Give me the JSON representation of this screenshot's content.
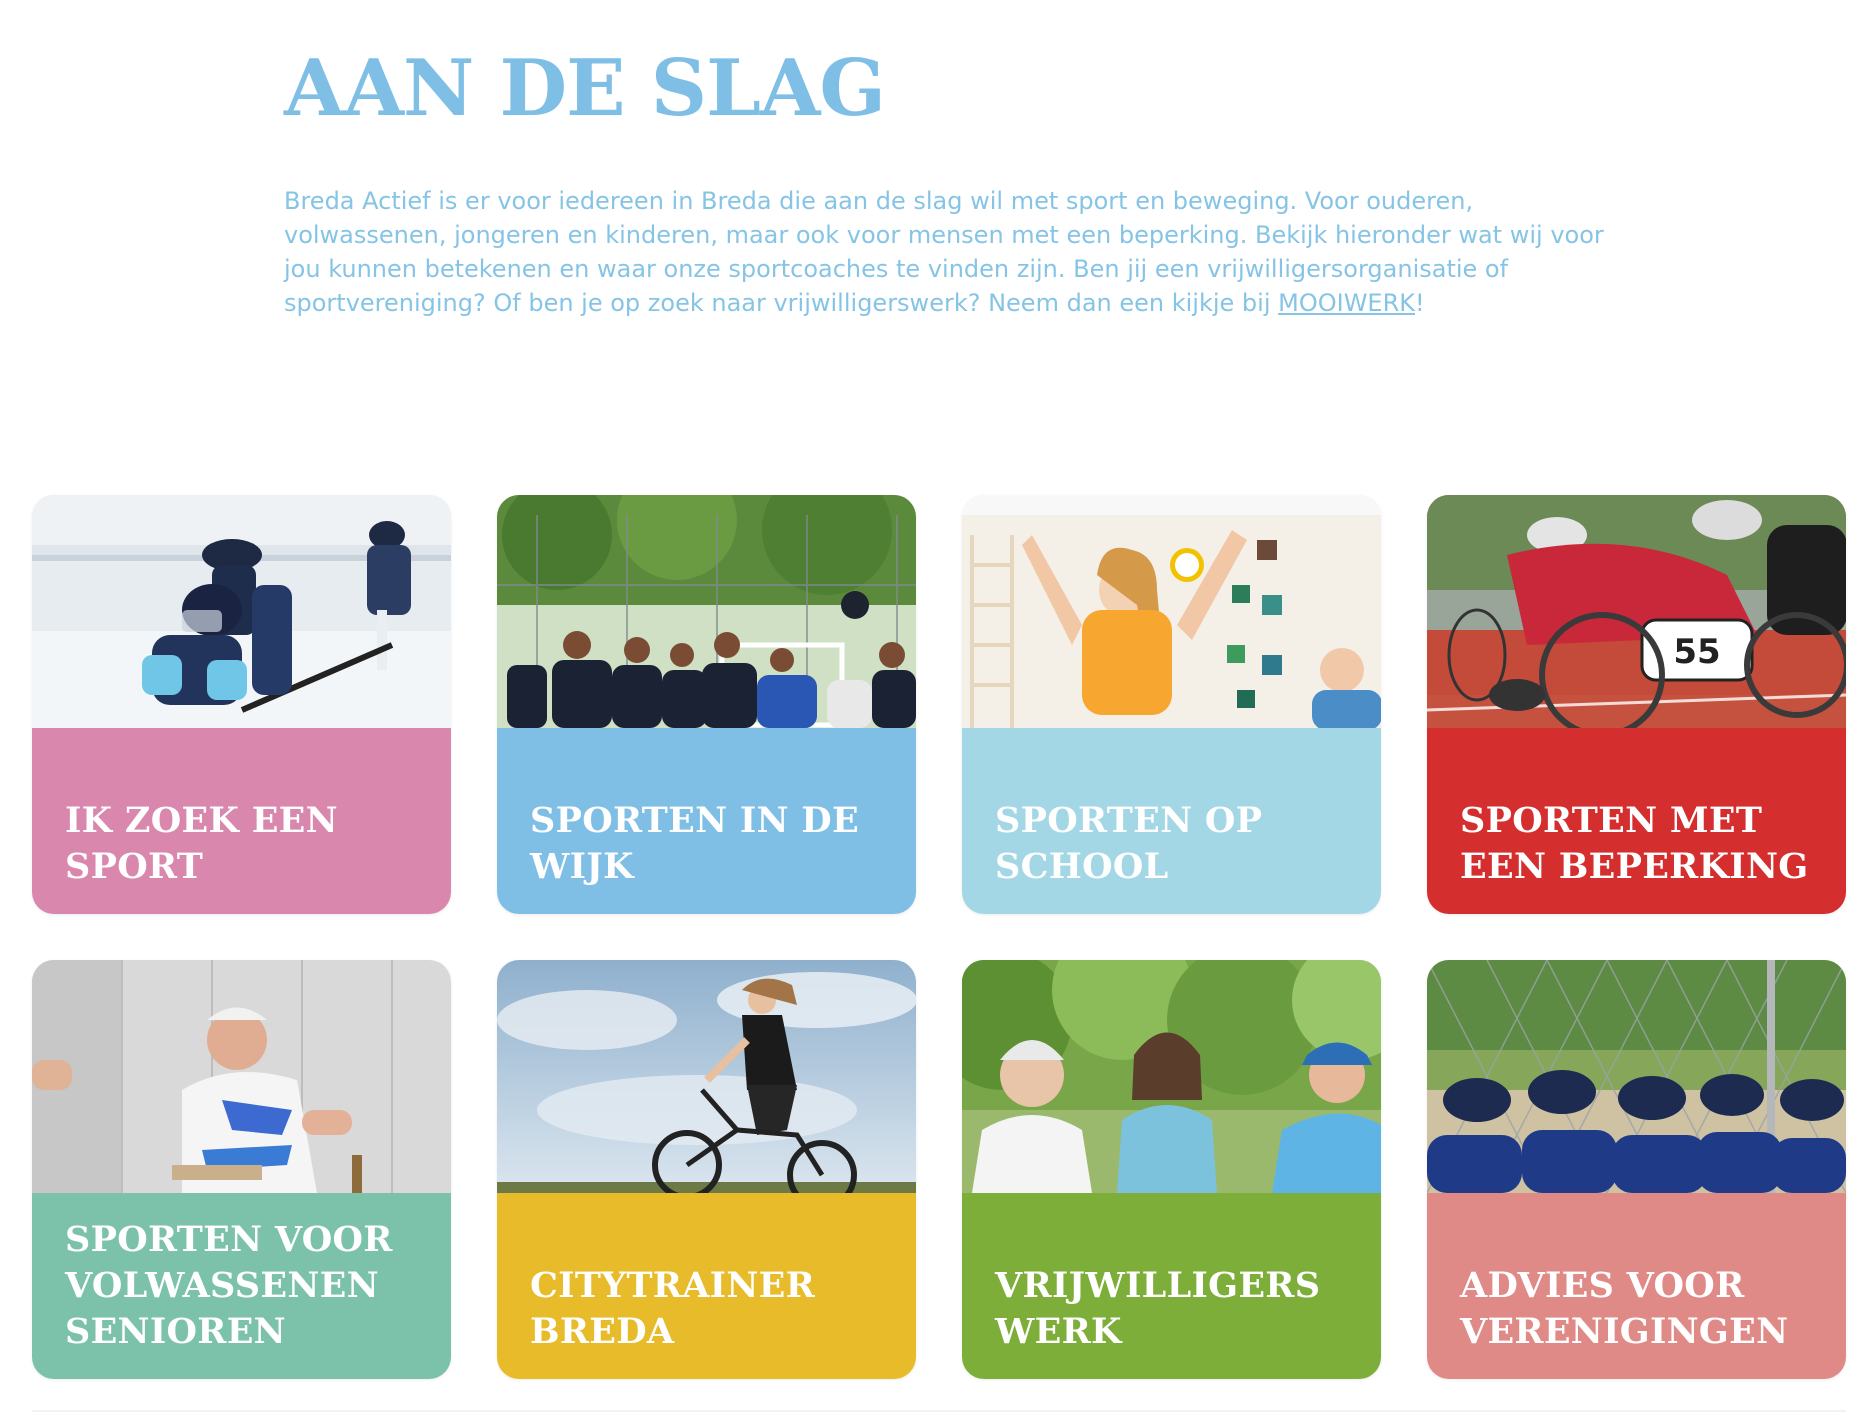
{
  "page": {
    "title": "AAN DE SLAG",
    "intro_text": "Breda Actief is er voor iedereen in Breda die aan de slag wil met sport en beweging. Voor ouderen, volwassenen, jongeren en kinderen, maar ook voor mensen met een beperking. Bekijk hieronder wat wij voor jou kunnen betekenen en waar onze sportcoaches te vinden zijn.  Ben jij een vrijwilligersorganisatie of sportvereniging? Of ben je op zoek naar vrijwilligerswerk? Neem dan een kijkje bij ",
    "intro_link": "MOOIWERK",
    "intro_suffix": "!"
  },
  "cards": [
    {
      "label": "IK ZOEK EEN\nSPORT",
      "color": "#d987ad",
      "photo": "ice-hockey-photo"
    },
    {
      "label": "SPORTEN IN DE\nWIJK",
      "color": "#80bfe5",
      "photo": "youth-football-photo"
    },
    {
      "label": "SPORTEN OP\nSCHOOL",
      "color": "#a3d7e6",
      "photo": "school-gym-photo"
    },
    {
      "label": "SPORTEN MET\nEEN BEPERKING",
      "color": "#d42e2e",
      "photo": "wheelchair-race-photo"
    },
    {
      "label": "SPORTEN VOOR\nVOLWASSENEN\nSENIOREN",
      "color": "#7cc2ab",
      "photo": "senior-sport-photo"
    },
    {
      "label": "CITYTRAINER\nBREDA",
      "color": "#e8bb2a",
      "photo": "bmx-photo"
    },
    {
      "label": "VRIJWILLIGERS\nWERK",
      "color": "#7eae3a",
      "photo": "volunteers-photo"
    },
    {
      "label": "ADVIES VOOR\nVERENIGINGEN",
      "color": "#e08a88",
      "photo": "baseball-team-photo"
    }
  ],
  "photo_badge": "55"
}
